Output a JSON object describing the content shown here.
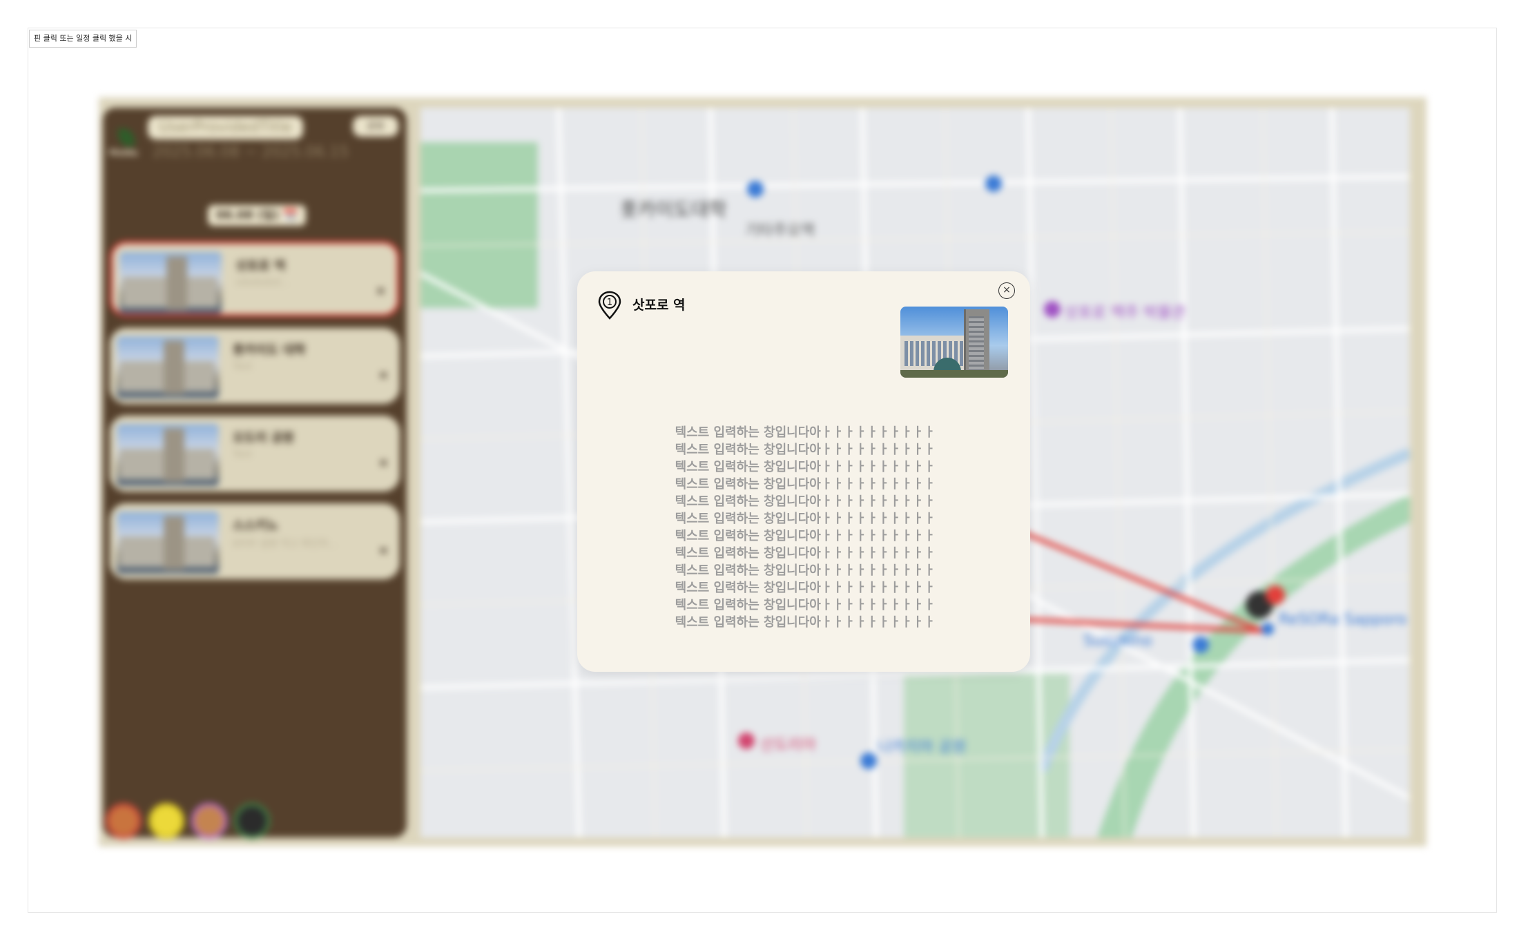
{
  "frame_label": "핀 클릭 또는 일정 클릭 했을 시",
  "sidebar": {
    "logo_text": "Mulda",
    "trip_title": "UserProvidedTitle",
    "share_label": "공유",
    "date_range": "2025.06.08 ~ 2025.06.15",
    "day_label": "06.08 (일) 📆",
    "places": [
      {
        "title": "삿포로 역",
        "subtitle": "sdsdsdsd...",
        "remove": "×"
      },
      {
        "title": "홋카이도 대학",
        "subtitle": "Text",
        "remove": "×"
      },
      {
        "title": "오도리 공원",
        "subtitle": "Text",
        "remove": "×"
      },
      {
        "title": "스스키노",
        "subtitle": "8자부 설명 적고 확인하...",
        "remove": "×"
      }
    ],
    "avatar_colors": [
      "#d9a03a",
      "#e9d21a",
      "#b86bc4",
      "#3f7f45"
    ]
  },
  "map": {
    "labels": [
      {
        "text": "홋카이도대학",
        "style": "big"
      },
      {
        "text": "기타주오역",
        "style": "normal"
      },
      {
        "text": "삿포로 맥주 박물관",
        "style": "purple"
      },
      {
        "text": "Susukino",
        "style": "blue"
      },
      {
        "text": "ReSORa Sapporo",
        "style": "blue"
      },
      {
        "text": "나카지마 공원",
        "style": "blue"
      },
      {
        "text": "산도리아",
        "style": "pink"
      }
    ],
    "route_color": "#e2403b"
  },
  "modal": {
    "index": "1",
    "title": "삿포로 역",
    "close_label": "×",
    "body_lines": [
      "텍스트 입력하는 창입니다아ㅏㅏㅏㅏㅏㅏㅏㅏㅏㅏ",
      "텍스트 입력하는 창입니다아ㅏㅏㅏㅏㅏㅏㅏㅏㅏㅏ",
      "텍스트 입력하는 창입니다아ㅏㅏㅏㅏㅏㅏㅏㅏㅏㅏ",
      "텍스트 입력하는 창입니다아ㅏㅏㅏㅏㅏㅏㅏㅏㅏㅏ",
      "텍스트 입력하는 창입니다아ㅏㅏㅏㅏㅏㅏㅏㅏㅏㅏ",
      "텍스트 입력하는 창입니다아ㅏㅏㅏㅏㅏㅏㅏㅏㅏㅏ",
      "텍스트 입력하는 창입니다아ㅏㅏㅏㅏㅏㅏㅏㅏㅏㅏ",
      "텍스트 입력하는 창입니다아ㅏㅏㅏㅏㅏㅏㅏㅏㅏㅏ",
      "텍스트 입력하는 창입니다아ㅏㅏㅏㅏㅏㅏㅏㅏㅏㅏ",
      "텍스트 입력하는 창입니다아ㅏㅏㅏㅏㅏㅏㅏㅏㅏㅏ",
      "텍스트 입력하는 창입니다아ㅏㅏㅏㅏㅏㅏㅏㅏㅏㅏ",
      "텍스트 입력하는 창입니다아ㅏㅏㅏㅏㅏㅏㅏㅏㅏㅏ"
    ]
  }
}
